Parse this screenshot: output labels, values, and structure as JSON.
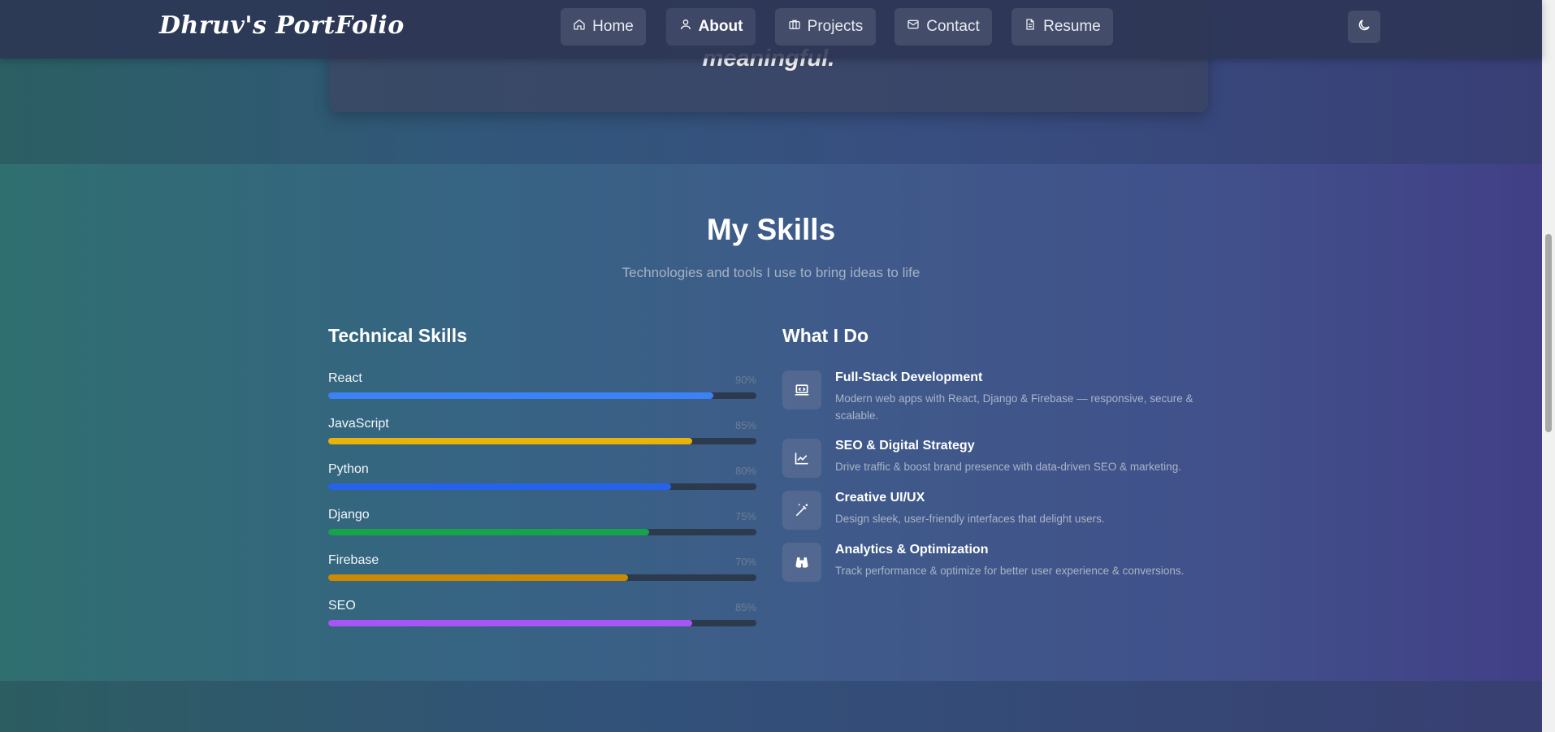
{
  "nav": {
    "brand": "Dhruv's PortFolio",
    "items": [
      {
        "label": "Home",
        "icon": "home-icon",
        "active": false
      },
      {
        "label": "About",
        "icon": "user-icon",
        "active": true
      },
      {
        "label": "Projects",
        "icon": "briefcase-icon",
        "active": false
      },
      {
        "label": "Contact",
        "icon": "mail-icon",
        "active": false
      },
      {
        "label": "Resume",
        "icon": "document-icon",
        "active": false
      }
    ],
    "theme_toggle_icon": "moon-icon"
  },
  "quote": {
    "text": "meaningful."
  },
  "skills_section": {
    "title": "My Skills",
    "subtitle": "Technologies and tools I use to bring ideas to life",
    "technical": {
      "title": "Technical Skills",
      "skills": [
        {
          "name": "React",
          "percent_label": "90%",
          "level": 0.9,
          "color": "#3b82f6"
        },
        {
          "name": "JavaScript",
          "percent_label": "85%",
          "level": 0.85,
          "color": "#eab308"
        },
        {
          "name": "Python",
          "percent_label": "80%",
          "level": 0.8,
          "color": "#2563eb"
        },
        {
          "name": "Django",
          "percent_label": "75%",
          "level": 0.75,
          "color": "#16a34a"
        },
        {
          "name": "Firebase",
          "percent_label": "70%",
          "level": 0.7,
          "color": "#ca8a04"
        },
        {
          "name": "SEO",
          "percent_label": "85%",
          "level": 0.85,
          "color": "#a855f7"
        }
      ]
    },
    "what_i_do": {
      "title": "What I Do",
      "services": [
        {
          "title": "Full-Stack Development",
          "description": "Modern web apps with React, Django & Firebase — responsive, secure & scalable.",
          "icon": "laptop-code-icon"
        },
        {
          "title": "SEO & Digital Strategy",
          "description": "Drive traffic & boost brand presence with data-driven SEO & marketing.",
          "icon": "chart-line-icon"
        },
        {
          "title": "Creative UI/UX",
          "description": "Design sleek, user-friendly interfaces that delight users.",
          "icon": "magic-wand-icon"
        },
        {
          "title": "Analytics & Optimization",
          "description": "Track performance & optimize for better user experience & conversions.",
          "icon": "binoculars-icon"
        }
      ]
    }
  }
}
